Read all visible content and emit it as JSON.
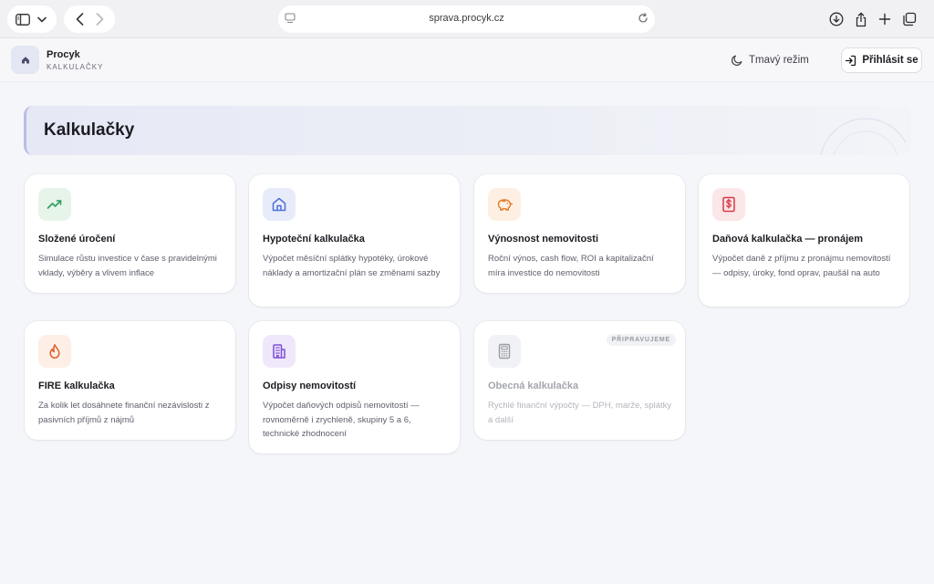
{
  "browser": {
    "url": "sprava.procyk.cz"
  },
  "header": {
    "brand_name": "Procyk",
    "brand_sub": "KALKULAČKY",
    "dark_mode_label": "Tmavý režim",
    "login_label": "Přihlásit se"
  },
  "hero": {
    "title": "Kalkulačky"
  },
  "cards": [
    {
      "icon": "trending-up-icon",
      "title": "Složené úročení",
      "description": "Simulace růstu investice v čase s pravidelnými vklady, výběry a vlivem inflace",
      "accent": "#2f9e5b"
    },
    {
      "icon": "home-icon",
      "title": "Hypoteční kalkulačka",
      "description": "Výpočet měsíční splátky hypotéky, úrokové náklady a amortizační plán se změnami sazby",
      "accent": "#4f6fd8"
    },
    {
      "icon": "piggy-bank-icon",
      "title": "Výnosnost nemovitosti",
      "description": "Roční výnos, cash flow, ROI a kapitalizační míra investice do nemovitosti",
      "accent": "#e07a2b"
    },
    {
      "icon": "receipt-dollar-icon",
      "title": "Daňová kalkulačka — pronájem",
      "description": "Výpočet daně z příjmu z pronájmu nemovitostí — odpisy, úroky, fond oprav, paušál na auto",
      "accent": "#d63a48"
    },
    {
      "icon": "flame-icon",
      "title": "FIRE kalkulačka",
      "description": "Za kolik let dosáhnete finanční nezávislosti z pasivních příjmů z nájmů",
      "accent": "#e2612f"
    },
    {
      "icon": "building-icon",
      "title": "Odpisy nemovitostí",
      "description": "Výpočet daňových odpisů nemovitostí — rovnoměrně i zrychleně, skupiny 5 a 6, technické zhodnocení",
      "accent": "#7b4fd9"
    },
    {
      "icon": "calculator-icon",
      "title": "Obecná kalkulačka",
      "description": "Rychlé finanční výpočty — DPH, marže, splátky a další",
      "badge": "PŘIPRAVUJEME",
      "accent": "#9a9ca5"
    }
  ]
}
